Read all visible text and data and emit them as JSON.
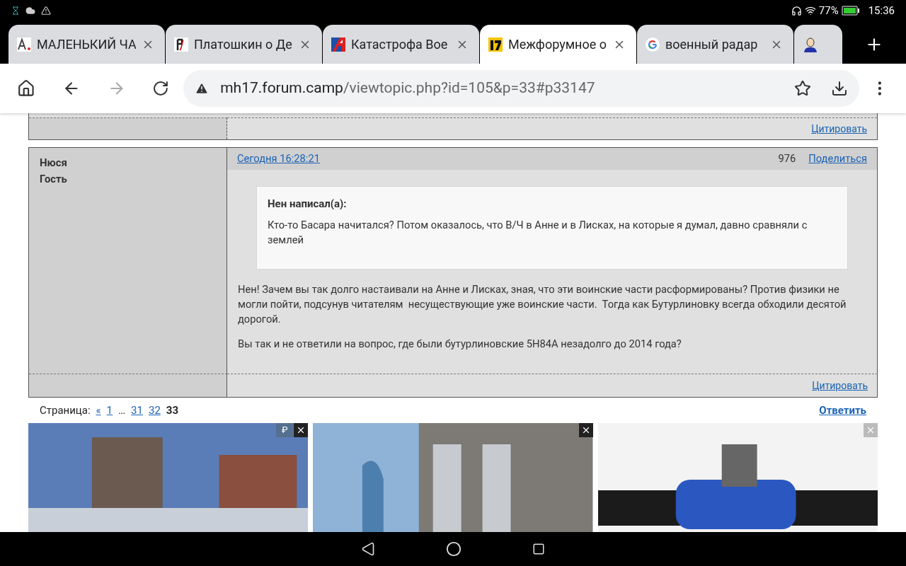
{
  "status_bar": {
    "battery": "77%",
    "time": "15:36"
  },
  "tabs": [
    {
      "title": "МАЛЕНЬКИЙ ЧА",
      "kind": "ar",
      "selected": false
    },
    {
      "title": "Платошкин о Де",
      "kind": "p",
      "selected": false
    },
    {
      "title": "Катастрофа Вое",
      "kind": "a",
      "selected": false
    },
    {
      "title": "Межфорумное о",
      "kind": "seventeen",
      "selected": true
    },
    {
      "title": "военный радар",
      "kind": "g",
      "selected": false
    }
  ],
  "address_bar": {
    "domain": "mh17.forum.camp",
    "path": "/viewtopic.php?id=105&p=33#p33147"
  },
  "previous_post": {
    "quote_link": "Цитировать"
  },
  "post": {
    "author": "Нюся",
    "role": "Гость",
    "date": "Сегодня 16:28:21",
    "number": "976",
    "share_link": "Поделиться",
    "quote": {
      "header": "Нен написал(а):",
      "text": "Кто-то Басара начитался? Потом оказалось, что В/Ч в Анне и в Лисках, на которые я думал, давно сравняли с землей"
    },
    "paragraphs": [
      "Нен! Зачем вы так долго настаивали на Анне и Лисках, зная, что эти воинские части расформированы? Против физики не могли пойти, подсунув читателям  несуществующие уже воинские части.  Тогда как Бутурлиновку всегда обходили десятой дорогой.",
      "Вы так и не ответили на вопрос, где были бутурлиновские 5Н84А незадолго до 2014 года?"
    ],
    "quote_link": "Цитировать"
  },
  "pagination": {
    "label": "Страница:",
    "pages": [
      {
        "text": "«",
        "kind": "link"
      },
      {
        "text": "1",
        "kind": "link"
      },
      {
        "text": "…",
        "kind": "gap"
      },
      {
        "text": "31",
        "kind": "link"
      },
      {
        "text": "32",
        "kind": "link"
      },
      {
        "text": "33",
        "kind": "current"
      }
    ]
  },
  "reply_link": "Ответить",
  "ads": [
    {
      "kind": "buildings",
      "badge": "₽"
    },
    {
      "kind": "tower"
    },
    {
      "kind": "pipe"
    }
  ]
}
